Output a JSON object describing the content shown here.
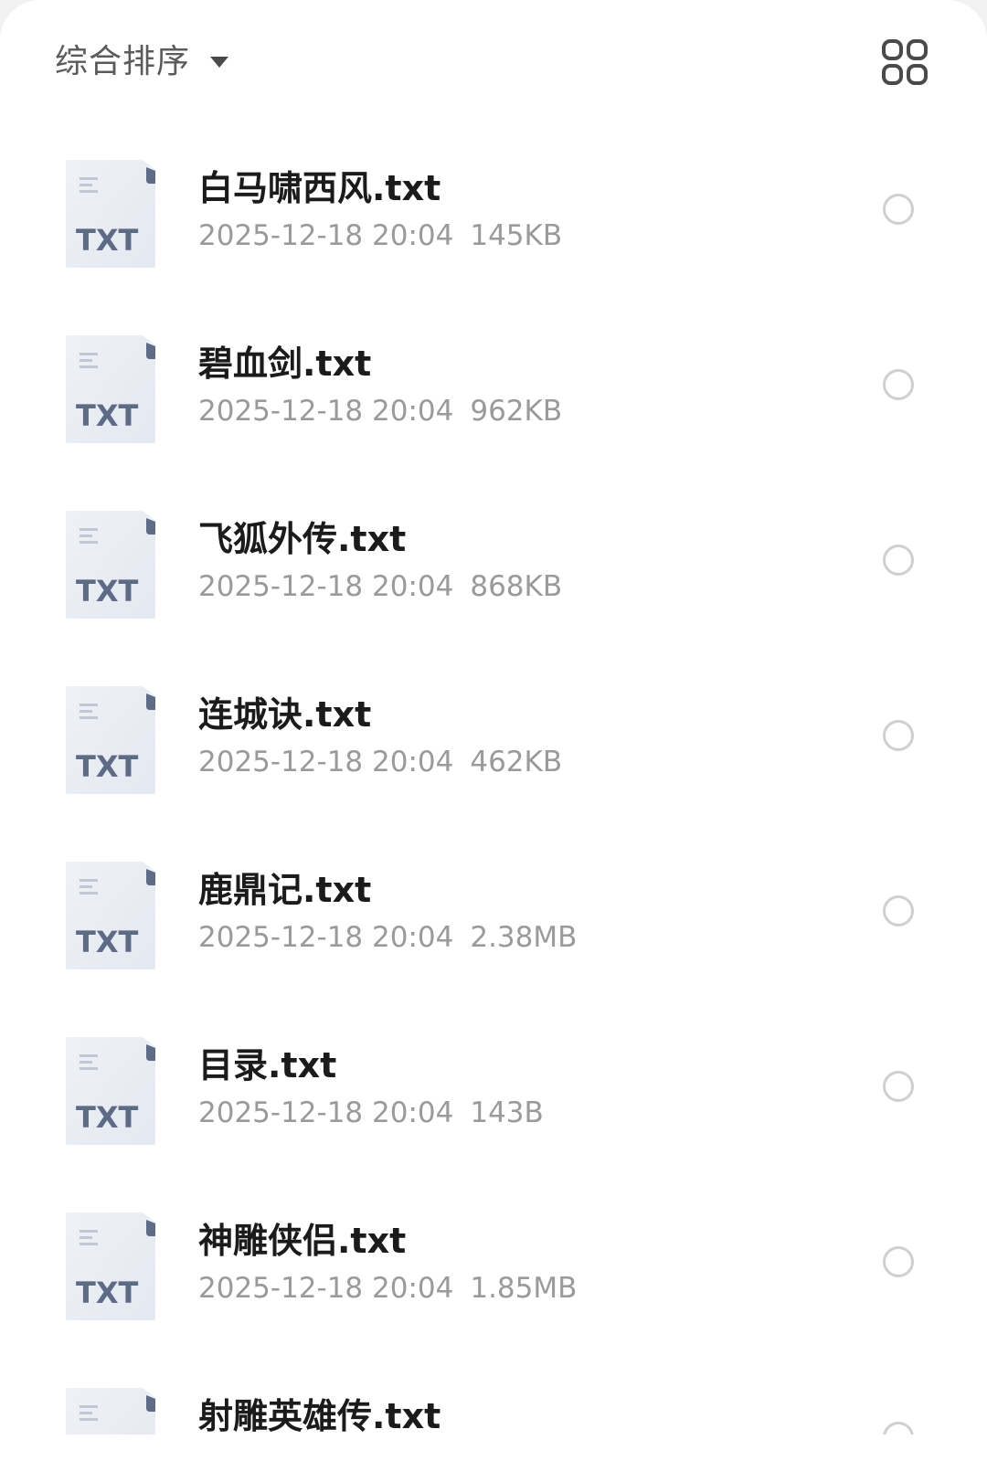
{
  "toolbar": {
    "sort_label": "综合排序",
    "sort_caret_icon": "caret-down-icon",
    "view_toggle_icon": "grid-view-icon"
  },
  "file_icon": {
    "label": "TXT",
    "icon": "txt-file-icon",
    "accent_color": "#5d6b85"
  },
  "files": [
    {
      "name": "白马啸西风.txt",
      "date": "2025-12-18 20:04",
      "size": "145KB"
    },
    {
      "name": "碧血剑.txt",
      "date": "2025-12-18 20:04",
      "size": "962KB"
    },
    {
      "name": "飞狐外传.txt",
      "date": "2025-12-18 20:04",
      "size": "868KB"
    },
    {
      "name": "连城诀.txt",
      "date": "2025-12-18 20:04",
      "size": "462KB"
    },
    {
      "name": "鹿鼎记.txt",
      "date": "2025-12-18 20:04",
      "size": "2.38MB"
    },
    {
      "name": "目录.txt",
      "date": "2025-12-18 20:04",
      "size": "143B"
    },
    {
      "name": "神雕侠侣.txt",
      "date": "2025-12-18 20:04",
      "size": "1.85MB"
    },
    {
      "name": "射雕英雄传.txt",
      "date": "",
      "size": ""
    }
  ]
}
